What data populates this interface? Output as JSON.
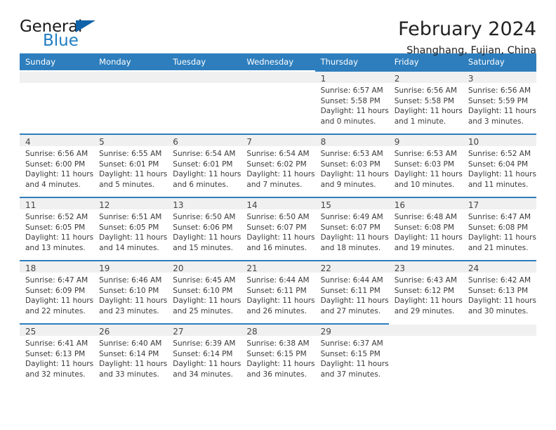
{
  "brand": {
    "name_top": "General",
    "name_bottom": "Blue",
    "triangle_color": "#1063a8",
    "blue_color": "#1f7ec4"
  },
  "header": {
    "title": "February 2024",
    "subtitle": "Shanghang, Fujian, China"
  },
  "theme": {
    "header_bar": "#2e7ebd",
    "daynum_band": "#f0f0f0",
    "text": "#333333"
  },
  "calendar": {
    "weekdays": [
      "Sunday",
      "Monday",
      "Tuesday",
      "Wednesday",
      "Thursday",
      "Friday",
      "Saturday"
    ],
    "weeks": [
      [
        {
          "day": "",
          "empty": true
        },
        {
          "day": "",
          "empty": true
        },
        {
          "day": "",
          "empty": true
        },
        {
          "day": "",
          "empty": true
        },
        {
          "day": "1",
          "sunrise": "Sunrise: 6:57 AM",
          "sunset": "Sunset: 5:58 PM",
          "daylight_1": "Daylight: 11 hours",
          "daylight_2": "and 0 minutes."
        },
        {
          "day": "2",
          "sunrise": "Sunrise: 6:56 AM",
          "sunset": "Sunset: 5:58 PM",
          "daylight_1": "Daylight: 11 hours",
          "daylight_2": "and 1 minute."
        },
        {
          "day": "3",
          "sunrise": "Sunrise: 6:56 AM",
          "sunset": "Sunset: 5:59 PM",
          "daylight_1": "Daylight: 11 hours",
          "daylight_2": "and 3 minutes."
        }
      ],
      [
        {
          "day": "4",
          "sunrise": "Sunrise: 6:56 AM",
          "sunset": "Sunset: 6:00 PM",
          "daylight_1": "Daylight: 11 hours",
          "daylight_2": "and 4 minutes."
        },
        {
          "day": "5",
          "sunrise": "Sunrise: 6:55 AM",
          "sunset": "Sunset: 6:01 PM",
          "daylight_1": "Daylight: 11 hours",
          "daylight_2": "and 5 minutes."
        },
        {
          "day": "6",
          "sunrise": "Sunrise: 6:54 AM",
          "sunset": "Sunset: 6:01 PM",
          "daylight_1": "Daylight: 11 hours",
          "daylight_2": "and 6 minutes."
        },
        {
          "day": "7",
          "sunrise": "Sunrise: 6:54 AM",
          "sunset": "Sunset: 6:02 PM",
          "daylight_1": "Daylight: 11 hours",
          "daylight_2": "and 7 minutes."
        },
        {
          "day": "8",
          "sunrise": "Sunrise: 6:53 AM",
          "sunset": "Sunset: 6:03 PM",
          "daylight_1": "Daylight: 11 hours",
          "daylight_2": "and 9 minutes."
        },
        {
          "day": "9",
          "sunrise": "Sunrise: 6:53 AM",
          "sunset": "Sunset: 6:03 PM",
          "daylight_1": "Daylight: 11 hours",
          "daylight_2": "and 10 minutes."
        },
        {
          "day": "10",
          "sunrise": "Sunrise: 6:52 AM",
          "sunset": "Sunset: 6:04 PM",
          "daylight_1": "Daylight: 11 hours",
          "daylight_2": "and 11 minutes."
        }
      ],
      [
        {
          "day": "11",
          "sunrise": "Sunrise: 6:52 AM",
          "sunset": "Sunset: 6:05 PM",
          "daylight_1": "Daylight: 11 hours",
          "daylight_2": "and 13 minutes."
        },
        {
          "day": "12",
          "sunrise": "Sunrise: 6:51 AM",
          "sunset": "Sunset: 6:05 PM",
          "daylight_1": "Daylight: 11 hours",
          "daylight_2": "and 14 minutes."
        },
        {
          "day": "13",
          "sunrise": "Sunrise: 6:50 AM",
          "sunset": "Sunset: 6:06 PM",
          "daylight_1": "Daylight: 11 hours",
          "daylight_2": "and 15 minutes."
        },
        {
          "day": "14",
          "sunrise": "Sunrise: 6:50 AM",
          "sunset": "Sunset: 6:07 PM",
          "daylight_1": "Daylight: 11 hours",
          "daylight_2": "and 16 minutes."
        },
        {
          "day": "15",
          "sunrise": "Sunrise: 6:49 AM",
          "sunset": "Sunset: 6:07 PM",
          "daylight_1": "Daylight: 11 hours",
          "daylight_2": "and 18 minutes."
        },
        {
          "day": "16",
          "sunrise": "Sunrise: 6:48 AM",
          "sunset": "Sunset: 6:08 PM",
          "daylight_1": "Daylight: 11 hours",
          "daylight_2": "and 19 minutes."
        },
        {
          "day": "17",
          "sunrise": "Sunrise: 6:47 AM",
          "sunset": "Sunset: 6:08 PM",
          "daylight_1": "Daylight: 11 hours",
          "daylight_2": "and 21 minutes."
        }
      ],
      [
        {
          "day": "18",
          "sunrise": "Sunrise: 6:47 AM",
          "sunset": "Sunset: 6:09 PM",
          "daylight_1": "Daylight: 11 hours",
          "daylight_2": "and 22 minutes."
        },
        {
          "day": "19",
          "sunrise": "Sunrise: 6:46 AM",
          "sunset": "Sunset: 6:10 PM",
          "daylight_1": "Daylight: 11 hours",
          "daylight_2": "and 23 minutes."
        },
        {
          "day": "20",
          "sunrise": "Sunrise: 6:45 AM",
          "sunset": "Sunset: 6:10 PM",
          "daylight_1": "Daylight: 11 hours",
          "daylight_2": "and 25 minutes."
        },
        {
          "day": "21",
          "sunrise": "Sunrise: 6:44 AM",
          "sunset": "Sunset: 6:11 PM",
          "daylight_1": "Daylight: 11 hours",
          "daylight_2": "and 26 minutes."
        },
        {
          "day": "22",
          "sunrise": "Sunrise: 6:44 AM",
          "sunset": "Sunset: 6:11 PM",
          "daylight_1": "Daylight: 11 hours",
          "daylight_2": "and 27 minutes."
        },
        {
          "day": "23",
          "sunrise": "Sunrise: 6:43 AM",
          "sunset": "Sunset: 6:12 PM",
          "daylight_1": "Daylight: 11 hours",
          "daylight_2": "and 29 minutes."
        },
        {
          "day": "24",
          "sunrise": "Sunrise: 6:42 AM",
          "sunset": "Sunset: 6:13 PM",
          "daylight_1": "Daylight: 11 hours",
          "daylight_2": "and 30 minutes."
        }
      ],
      [
        {
          "day": "25",
          "sunrise": "Sunrise: 6:41 AM",
          "sunset": "Sunset: 6:13 PM",
          "daylight_1": "Daylight: 11 hours",
          "daylight_2": "and 32 minutes."
        },
        {
          "day": "26",
          "sunrise": "Sunrise: 6:40 AM",
          "sunset": "Sunset: 6:14 PM",
          "daylight_1": "Daylight: 11 hours",
          "daylight_2": "and 33 minutes."
        },
        {
          "day": "27",
          "sunrise": "Sunrise: 6:39 AM",
          "sunset": "Sunset: 6:14 PM",
          "daylight_1": "Daylight: 11 hours",
          "daylight_2": "and 34 minutes."
        },
        {
          "day": "28",
          "sunrise": "Sunrise: 6:38 AM",
          "sunset": "Sunset: 6:15 PM",
          "daylight_1": "Daylight: 11 hours",
          "daylight_2": "and 36 minutes."
        },
        {
          "day": "29",
          "sunrise": "Sunrise: 6:37 AM",
          "sunset": "Sunset: 6:15 PM",
          "daylight_1": "Daylight: 11 hours",
          "daylight_2": "and 37 minutes."
        },
        {
          "day": "",
          "empty": true
        },
        {
          "day": "",
          "empty": true
        }
      ]
    ]
  }
}
